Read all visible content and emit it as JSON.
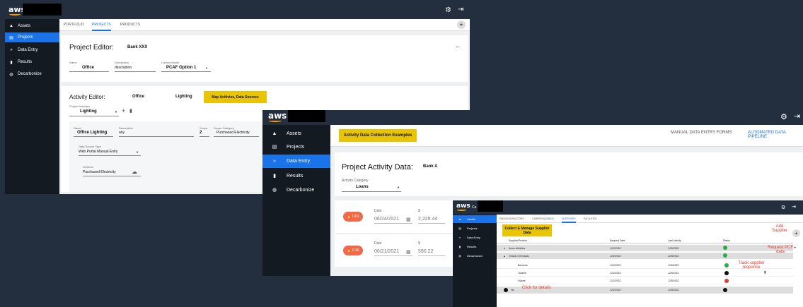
{
  "brand": "aws",
  "window1": {
    "nav": [
      "Assets",
      "Projects",
      "Data Entry",
      "Results",
      "Decarbonize"
    ],
    "tabs": [
      "PORTFOLIO",
      "PROJECTS",
      "PRODUCTS"
    ],
    "project_editor": {
      "title": "Project Editor:",
      "bank": "Bank XXX",
      "name_label": "Name",
      "name_value": "Office",
      "desc_label": "Description",
      "desc_value": "description",
      "model_label": "Carbon Model",
      "model_value": "PCAF Option 1"
    },
    "activity_editor": {
      "title": "Activity Editor:",
      "office": "Office",
      "lighting": "Lighting",
      "callout": "Map Acitivies, Data Sources",
      "activities_label": "Project Activities",
      "activities_value": "Lighting",
      "name_label": "Name",
      "name_value": "Office Lighting",
      "desc_label": "Description",
      "desc_value": "any",
      "scope_label": "Scope",
      "scope_value": "2",
      "scope_cat_label": "Scope Category",
      "scope_cat_value": "Purchased Electricity",
      "source_type_label": "Data Source Type",
      "source_type_value": "Web Portal Manual Entry",
      "schema_label": "Schema",
      "schema_value": "Purchased Electricity"
    }
  },
  "window2": {
    "nav": [
      "Assets",
      "Projects",
      "Data Entry",
      "Results",
      "Decarbonize"
    ],
    "callout": "Activity Data Collection Examples",
    "tabs": [
      "MANUAL DATA ENTRY FORMS",
      "AUTOMATED DATA PIPELINE"
    ],
    "project_activity": {
      "title": "Project Activity Data:",
      "bank": "Bank A",
      "category_label": "Activity Category",
      "category_value": "Loans"
    },
    "rows": [
      {
        "pill": "0.01",
        "date_label": "Date",
        "date": "06/24/2021",
        "amt_label": "$",
        "amount": "2,229.44"
      },
      {
        "pill": "0.36",
        "date_label": "Date",
        "date": "06/21/2021",
        "amt_label": "$",
        "amount": "590.22"
      }
    ]
  },
  "window3": {
    "title_frag": "Ca",
    "nav": [
      "Assets",
      "Projects",
      "Data Entry",
      "Results",
      "Decarbonize"
    ],
    "tabs": [
      "EMISSION FACTORS",
      "CARBON MODELS",
      "SUPPLIERS",
      "FACILITIES"
    ],
    "callout": "Collect & Manage Supplier Data",
    "add_supplier": "Add Supplier",
    "request_pcf": "Request PCF data",
    "track": "Track supplier response",
    "click_details": "Click for details",
    "headers": [
      "Supplier/Product",
      "Request Date",
      "Last Activity",
      "Status"
    ],
    "rows": [
      {
        "name": "Acorn Athletics",
        "req": "12/2/2022",
        "last": "12/5/2022"
      },
      {
        "name": "Ontario Chemicals",
        "req": "12/2/2022",
        "last": "12/5/2022"
      },
      {
        "name": "Benzene",
        "req": "12/2/2022",
        "last": "12/5/2022"
      },
      {
        "name": "Toluene",
        "req": "12/2/2022",
        "last": "12/5/2022"
      },
      {
        "name": "Xylene",
        "req": "12/2/2022",
        "last": "12/5/2022"
      },
      {
        "name": "Ha",
        "req": "12/2/2022",
        "last": "12/5/2022"
      }
    ]
  }
}
